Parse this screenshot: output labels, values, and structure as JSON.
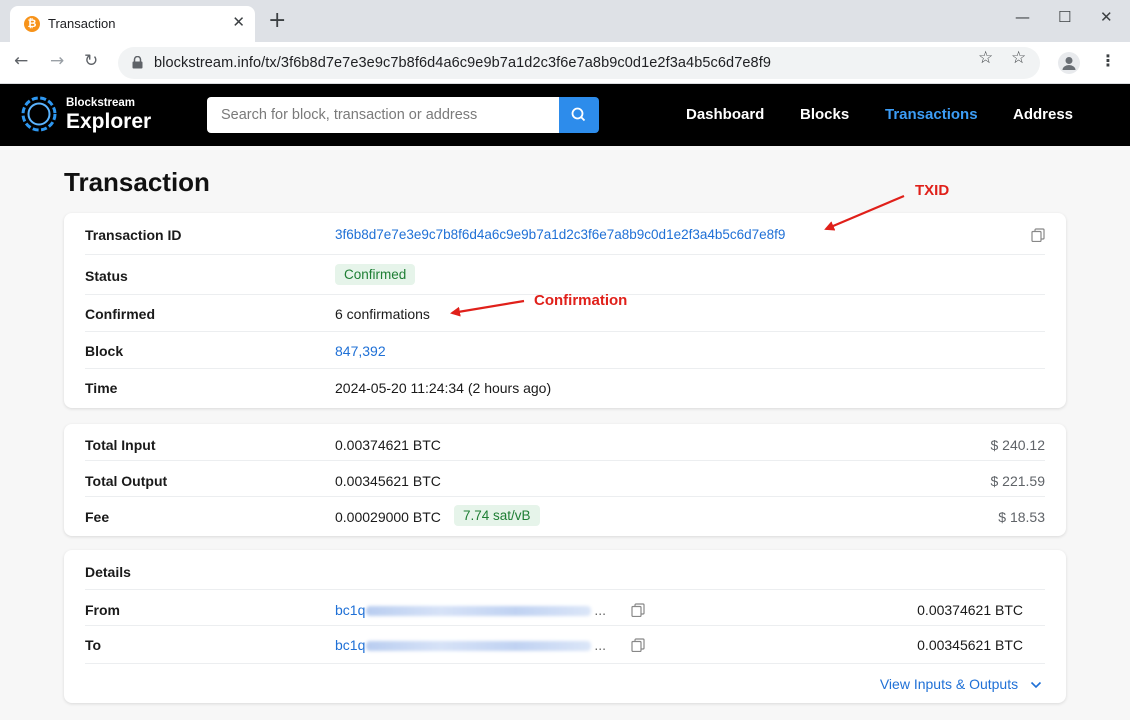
{
  "browser": {
    "tab_title": "Transaction",
    "tab_favicon": "₿",
    "url": "blockstream.info/tx/3f6b8d7e7e3e9c7b8f6d4a6c9e9b7a1d2c3f6e7a8b9c0d1e2f3a4b5c6d7e8f9"
  },
  "site": {
    "brand_small": "Blockstream",
    "brand_big": "Explorer",
    "search_placeholder": "Search for block, transaction or address",
    "nav": [
      {
        "label": "Dashboard",
        "active": false
      },
      {
        "label": "Blocks",
        "active": false
      },
      {
        "label": "Transactions",
        "active": true
      },
      {
        "label": "Address",
        "active": false
      }
    ]
  },
  "page_title": "Transaction",
  "summary": {
    "txid_label": "Transaction ID",
    "txid": "3f6b8d7e7e3e9c7b8f6d4a6c9e9b7a1d2c3f6e7a8b9c0d1e2f3a4b5c6d7e8f9",
    "status_label": "Status",
    "status": "Confirmed",
    "confirmed_label": "Confirmed",
    "confirmations": "6 confirmations",
    "block_label": "Block",
    "block": "847,392",
    "time_label": "Time",
    "time": "2024-05-20 11:24:34 (2 hours ago)"
  },
  "amounts": {
    "total_input_label": "Total Input",
    "total_input": "0.00374621 BTC",
    "total_input_usd": "$ 240.12",
    "total_output_label": "Total Output",
    "total_output": "0.00345621 BTC",
    "total_output_usd": "$ 221.59",
    "fee_label": "Fee",
    "fee": "0.00029000 BTC",
    "fee_rate": "7.74 sat/vB",
    "fee_usd": "$ 18.53"
  },
  "details": {
    "title": "Details",
    "from_label": "From",
    "from_prefix": "bc1q",
    "from_amount": "0.00374621 BTC",
    "to_label": "To",
    "to_prefix": "bc1q",
    "to_amount": "0.00345621 BTC",
    "ellipsis": "...",
    "view_link": "View Inputs & Outputs"
  },
  "annotations": {
    "txid": "TXID",
    "confirmation": "Confirmation",
    "color": "#e0201a"
  },
  "colors": {
    "link": "#1f70d6",
    "active_nav": "#3c9df6",
    "search_button": "#2d8ceb",
    "badge_bg": "#e6f4ea",
    "badge_text": "#1e7e34"
  }
}
